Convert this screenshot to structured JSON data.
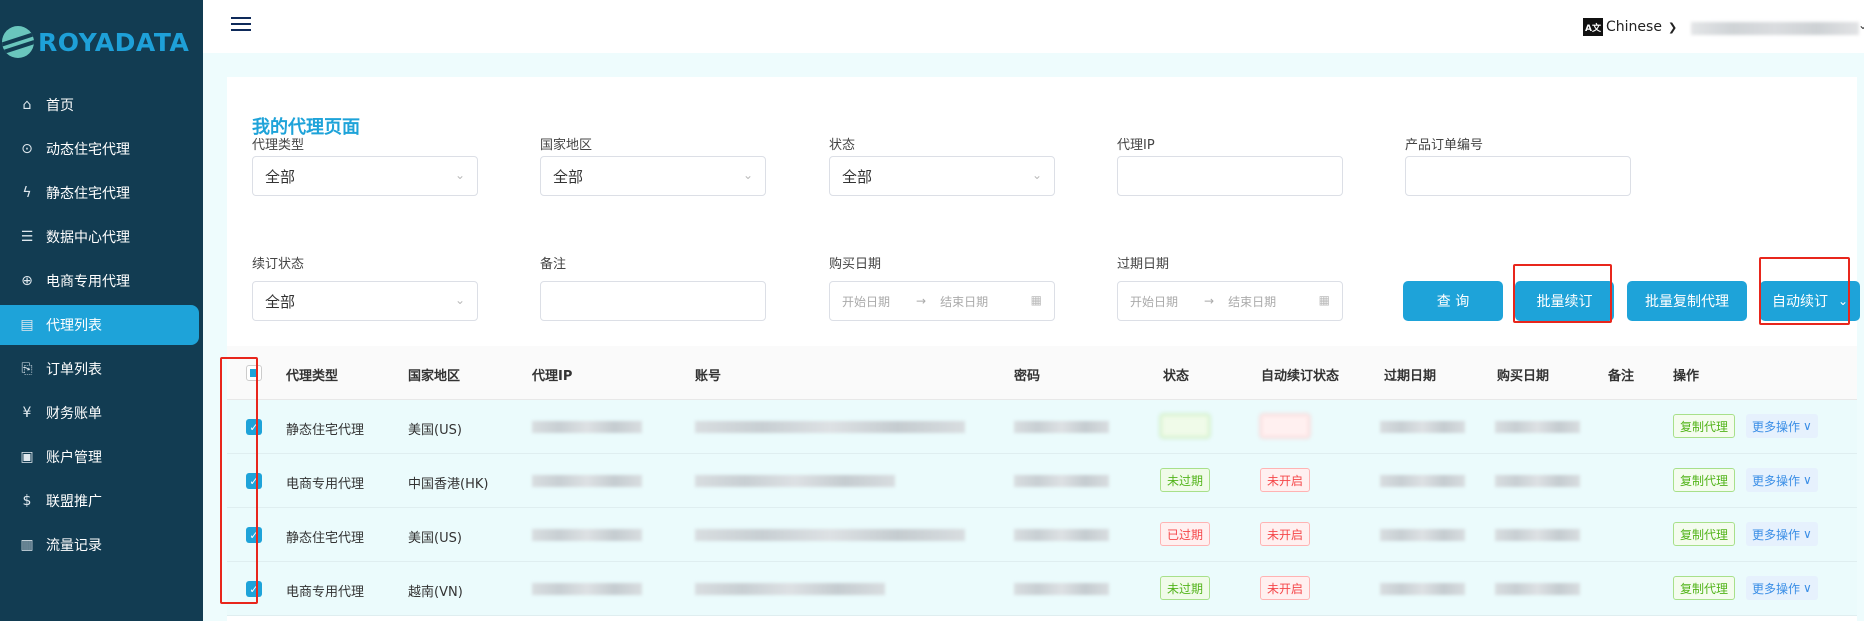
{
  "brand": {
    "name": "ROYADATA",
    "accent": "#1ea3d9",
    "sidebar_bg": "#123c52"
  },
  "sidebar": {
    "items": [
      {
        "label": "首页",
        "icon": "home-icon"
      },
      {
        "label": "动态住宅代理",
        "icon": "location-pin-icon"
      },
      {
        "label": "静态住宅代理",
        "icon": "lightning-icon"
      },
      {
        "label": "数据中心代理",
        "icon": "server-icon"
      },
      {
        "label": "电商专用代理",
        "icon": "globe-icon"
      },
      {
        "label": "代理列表",
        "icon": "storefront-icon",
        "active": true
      },
      {
        "label": "订单列表",
        "icon": "document-search-icon"
      },
      {
        "label": "财务账单",
        "icon": "yen-calendar-icon"
      },
      {
        "label": "账户管理",
        "icon": "user-document-icon"
      },
      {
        "label": "联盟推广",
        "icon": "dollar-circle-icon"
      },
      {
        "label": "流量记录",
        "icon": "bar-chart-icon"
      }
    ]
  },
  "header": {
    "language": "Chinese"
  },
  "page": {
    "title": "我的代理页面"
  },
  "filters": {
    "proxy_type": {
      "label": "代理类型",
      "value": "全部"
    },
    "region": {
      "label": "国家地区",
      "value": "全部"
    },
    "status": {
      "label": "状态",
      "value": "全部"
    },
    "proxy_ip": {
      "label": "代理IP",
      "value": ""
    },
    "order_no": {
      "label": "产品订单编号",
      "value": ""
    },
    "renew_status": {
      "label": "续订状态",
      "value": "全部"
    },
    "note": {
      "label": "备注",
      "value": ""
    },
    "purchase_date": {
      "label": "购买日期",
      "start_placeholder": "开始日期",
      "end_placeholder": "结束日期",
      "separator": "→"
    },
    "expire_date": {
      "label": "过期日期",
      "start_placeholder": "开始日期",
      "end_placeholder": "结束日期",
      "separator": "→"
    }
  },
  "buttons": {
    "query": "查 询",
    "batch_renew": "批量续订",
    "batch_copy": "批量复制代理",
    "auto_renew": "自动续订"
  },
  "table": {
    "columns": [
      "代理类型",
      "国家地区",
      "代理IP",
      "账号",
      "密码",
      "状态",
      "自动续订状态",
      "过期日期",
      "购买日期",
      "备注",
      "操作"
    ],
    "rows": [
      {
        "checked": true,
        "type": "静态住宅代理",
        "region": "美国(US)",
        "status": "",
        "auto_renew": "",
        "status_color": "green"
      },
      {
        "checked": true,
        "type": "电商专用代理",
        "region": "中国香港(HK)",
        "status": "未过期",
        "auto_renew": "未开启",
        "status_color": "green"
      },
      {
        "checked": true,
        "type": "静态住宅代理",
        "region": "美国(US)",
        "status": "已过期",
        "auto_renew": "未开启",
        "status_color": "red"
      },
      {
        "checked": true,
        "type": "电商专用代理",
        "region": "越南(VN)",
        "status": "未过期",
        "auto_renew": "未开启",
        "status_color": "green"
      }
    ],
    "actions": {
      "copy": "复制代理",
      "more": "更多操作"
    }
  }
}
